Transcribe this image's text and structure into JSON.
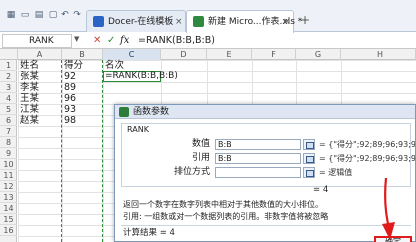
{
  "tabs": [
    {
      "label": "Docer-在线模板",
      "icon_color": "#2b64c4"
    },
    {
      "label": "新建 Micro...作表.xls *",
      "icon_color": "#2f8a3f"
    }
  ],
  "new_tab_label": "+",
  "formula_bar": {
    "name_box": "RANK",
    "fx_label": "fx",
    "formula": "=RANK(B:B,B:B)"
  },
  "columns": [
    "A",
    "B",
    "C",
    "D",
    "E",
    "F",
    "G",
    "H"
  ],
  "rows": [
    "1",
    "2",
    "3",
    "4",
    "5",
    "6",
    "7",
    "8",
    "9",
    "10",
    "11",
    "12",
    "13",
    "14",
    "15",
    "16"
  ],
  "cells": {
    "A1": "姓名",
    "B1": "得分",
    "C1": "名次",
    "A2": "张某",
    "B2": "92",
    "C2": "=RANK(B:B,B:B)",
    "A3": "李某",
    "B3": "89",
    "A4": "王某",
    "B4": "96",
    "A5": "江某",
    "B5": "93",
    "A6": "赵某",
    "B6": "98"
  },
  "dialog": {
    "title": "函数参数",
    "function_name": "RANK",
    "args": [
      {
        "label": "数值",
        "value": "B:B",
        "result": "= {\"得分\";92;89;96;93;98;0;0"
      },
      {
        "label": "引用",
        "value": "B:B",
        "result": "= {\"得分\";92;89;96;93;98;0;0"
      },
      {
        "label": "排位方式",
        "value": "",
        "result": "= 逻辑值"
      }
    ],
    "inline_result": "= 4",
    "description": "返回一个数字在数字列表中相对于其他数值的大小排位。",
    "arg_description": "引用:  一组数或对一个数据列表的引用。非数字值将被忽略",
    "calc_result": "计算结果 = 4",
    "ok_label": "确定"
  },
  "colors": {
    "accent_green": "#2e8b3a",
    "highlight_red": "#e01b1b"
  }
}
